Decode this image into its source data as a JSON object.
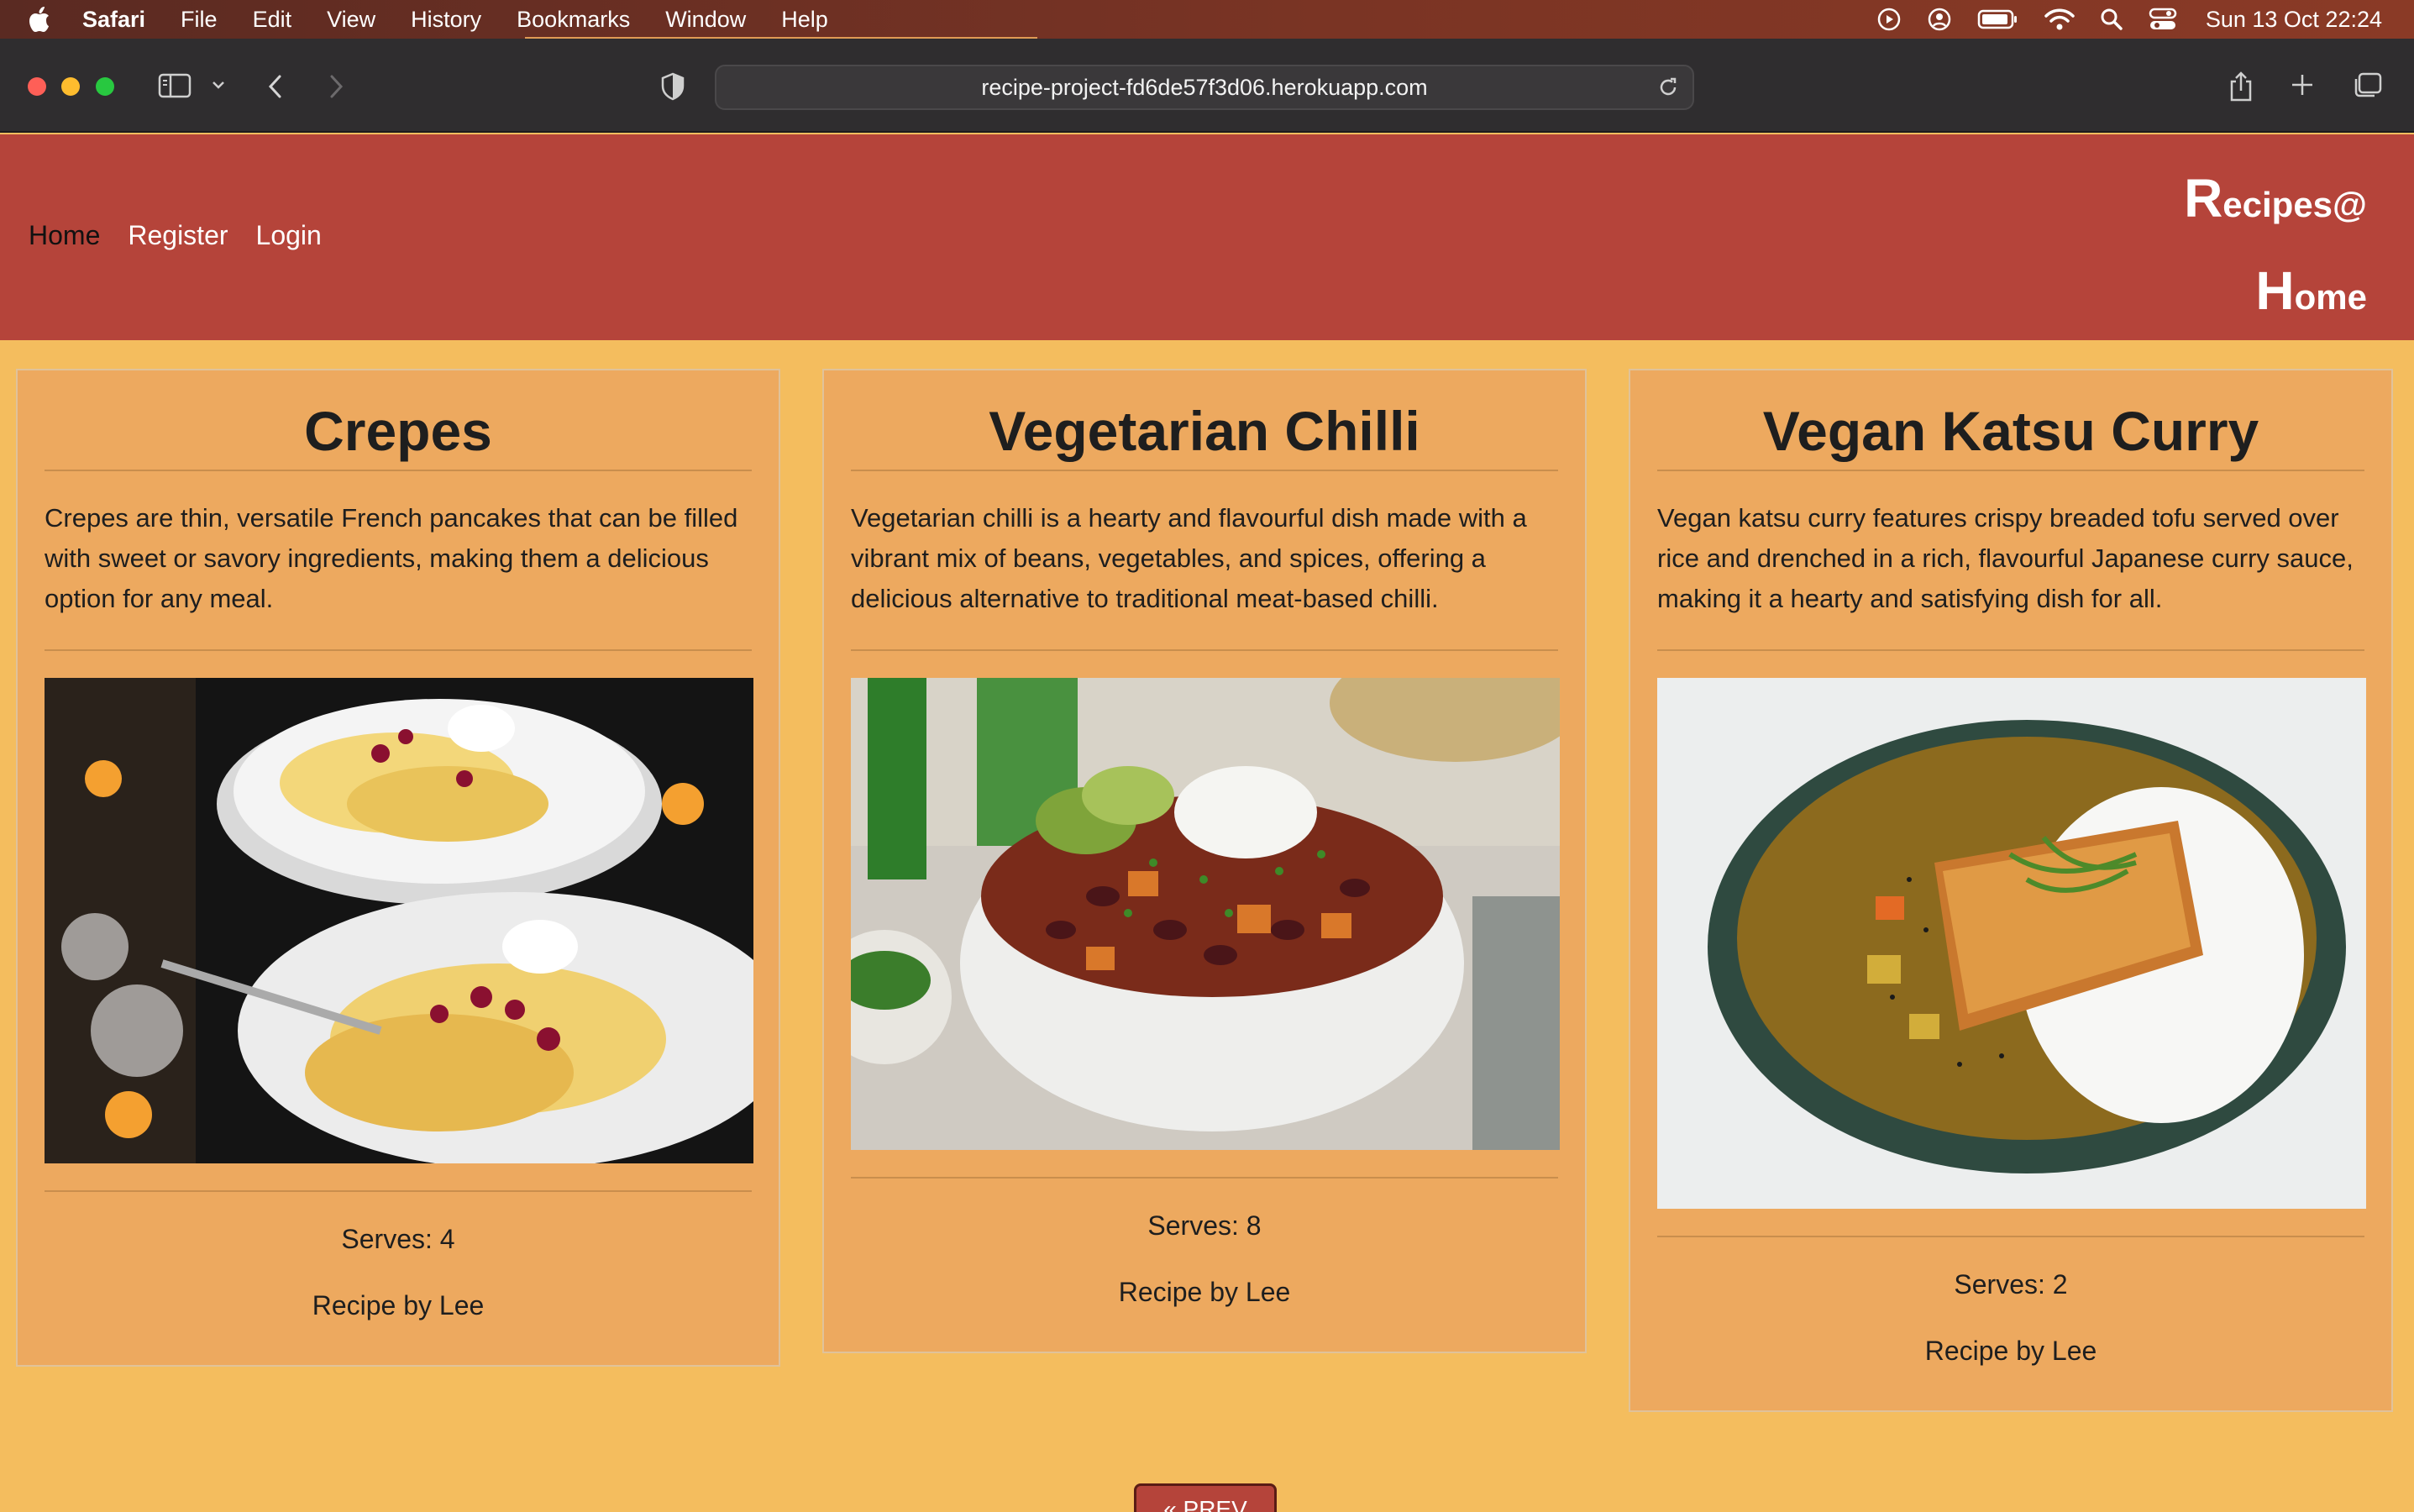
{
  "menubar": {
    "app": "Safari",
    "items": [
      "File",
      "Edit",
      "View",
      "History",
      "Bookmarks",
      "Window",
      "Help"
    ],
    "clock": "Sun 13 Oct  22:24"
  },
  "browser": {
    "url": "recipe-project-fd6de57f3d06.herokuapp.com"
  },
  "site": {
    "nav": [
      "Home",
      "Register",
      "Login"
    ],
    "brand_line1_cap": "R",
    "brand_line1_rest": "ecipes@",
    "brand_line2_cap": "H",
    "brand_line2_rest": "ome"
  },
  "recipes": [
    {
      "title": "Crepes",
      "description": "Crepes are thin, versatile French pancakes that can be filled with sweet or savory ingredients, making them a delicious option for any meal.",
      "serves": "Serves: 4",
      "author": "Recipe by Lee"
    },
    {
      "title": "Vegetarian Chilli",
      "description": "Vegetarian chilli is a hearty and flavourful dish made with a vibrant mix of beans, vegetables, and spices, offering a delicious alternative to traditional meat-based chilli.",
      "serves": "Serves: 8",
      "author": "Recipe by Lee"
    },
    {
      "title": "Vegan Katsu Curry",
      "description": "Vegan katsu curry features crispy breaded tofu served over rice and drenched in a rich, flavourful Japanese curry sauce, making it a hearty and satisfying dish for all.",
      "serves": "Serves: 2",
      "author": "Recipe by Lee"
    }
  ],
  "pagination": {
    "prev_label": "« PREV"
  }
}
